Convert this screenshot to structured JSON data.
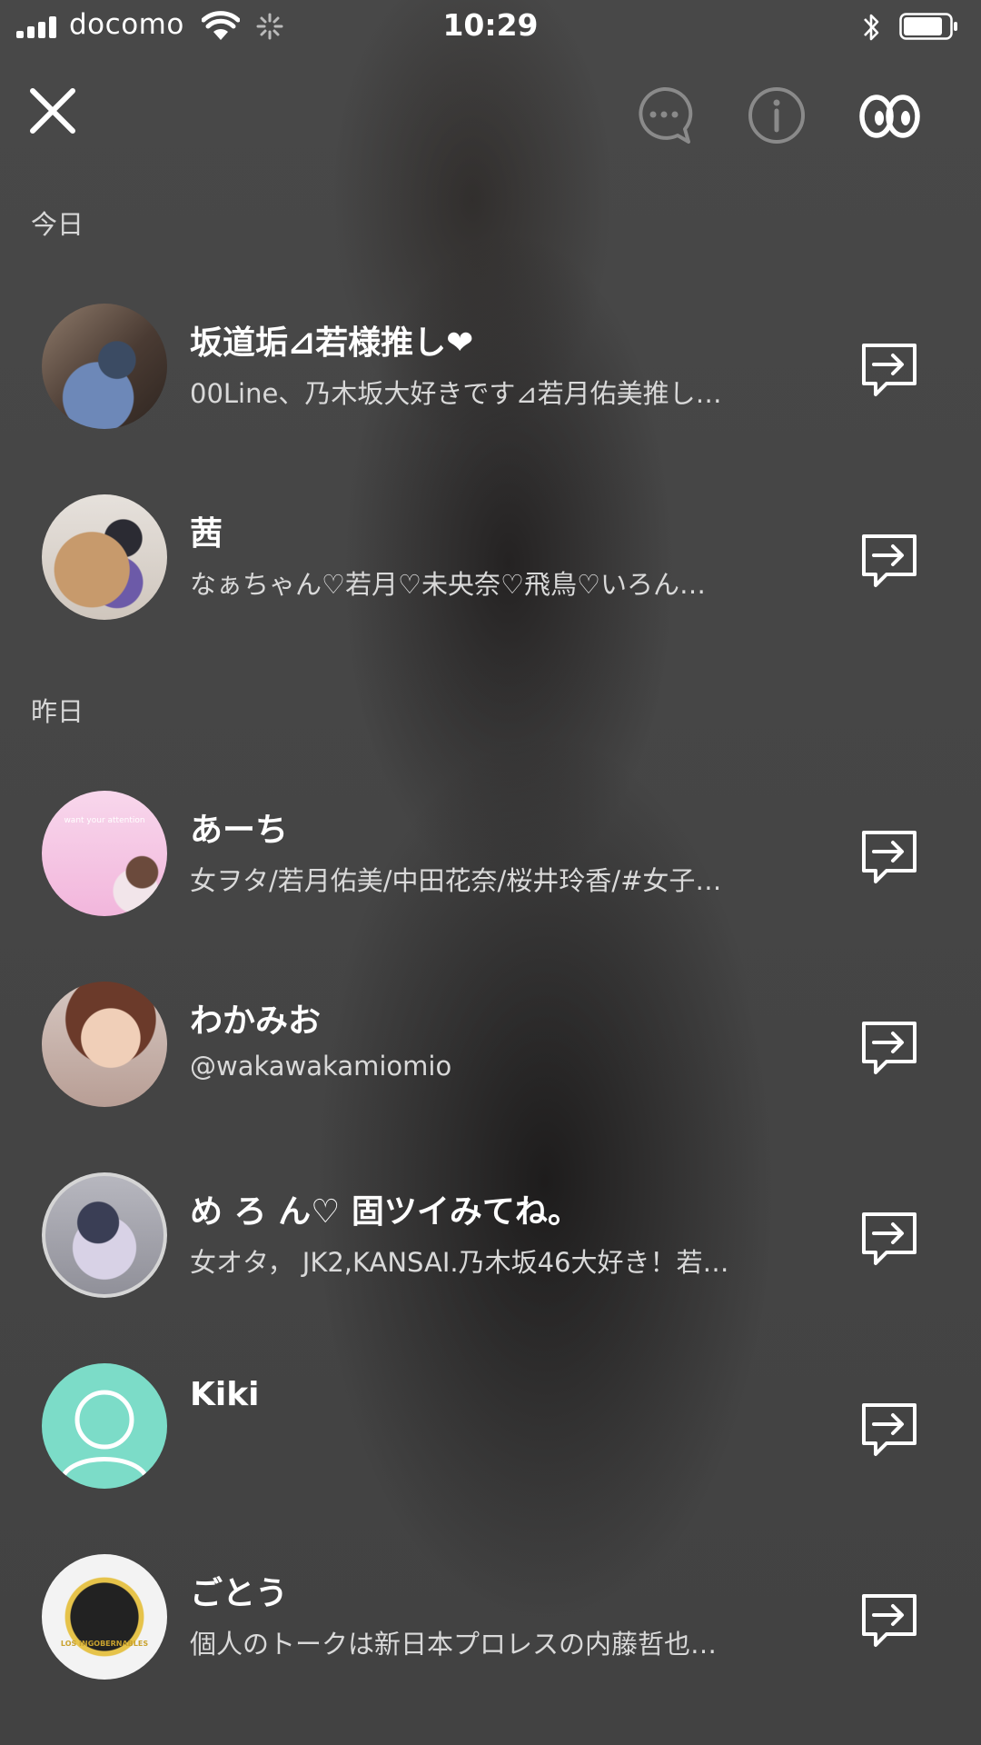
{
  "status_bar": {
    "carrier": "docomo",
    "time": "10:29",
    "battery_level": 0.85
  },
  "header": {
    "icons": [
      "close-icon",
      "chat-bubble-icon",
      "info-icon",
      "eyes-icon"
    ]
  },
  "sections": [
    {
      "label": "今日"
    },
    {
      "label": "昨日"
    }
  ],
  "rows": [
    {
      "name": "坂道垢⊿若様推し❤",
      "subtitle": "00Line、乃木坂大好きです⊿若月佑美推し…"
    },
    {
      "name": "茜",
      "subtitle": "なぁちゃん♡若月♡未央奈♡飛鳥♡いろん…"
    },
    {
      "name": "あーち",
      "subtitle": "女ヲタ/若月佑美/中田花奈/桜井玲香/#女子…",
      "avatar_caption": "want your attention"
    },
    {
      "name": "わかみお",
      "subtitle": "@wakawakamiomio"
    },
    {
      "name": "め ろ ん♡ 固ツイみてね。",
      "subtitle": "女オタ， JK2,KANSAI.乃木坂46大好き！若…"
    },
    {
      "name": "Kiki",
      "subtitle": ""
    },
    {
      "name": "ごとう",
      "subtitle": "個人のトークは新日本プロレスの内藤哲也…",
      "avatar_caption": "LOS INGOBERNABLES"
    }
  ],
  "colors": {
    "background": "#454545",
    "default_avatar": "#7cdcc8",
    "text_primary": "#ffffff",
    "text_secondary": "#d9d9d9"
  }
}
